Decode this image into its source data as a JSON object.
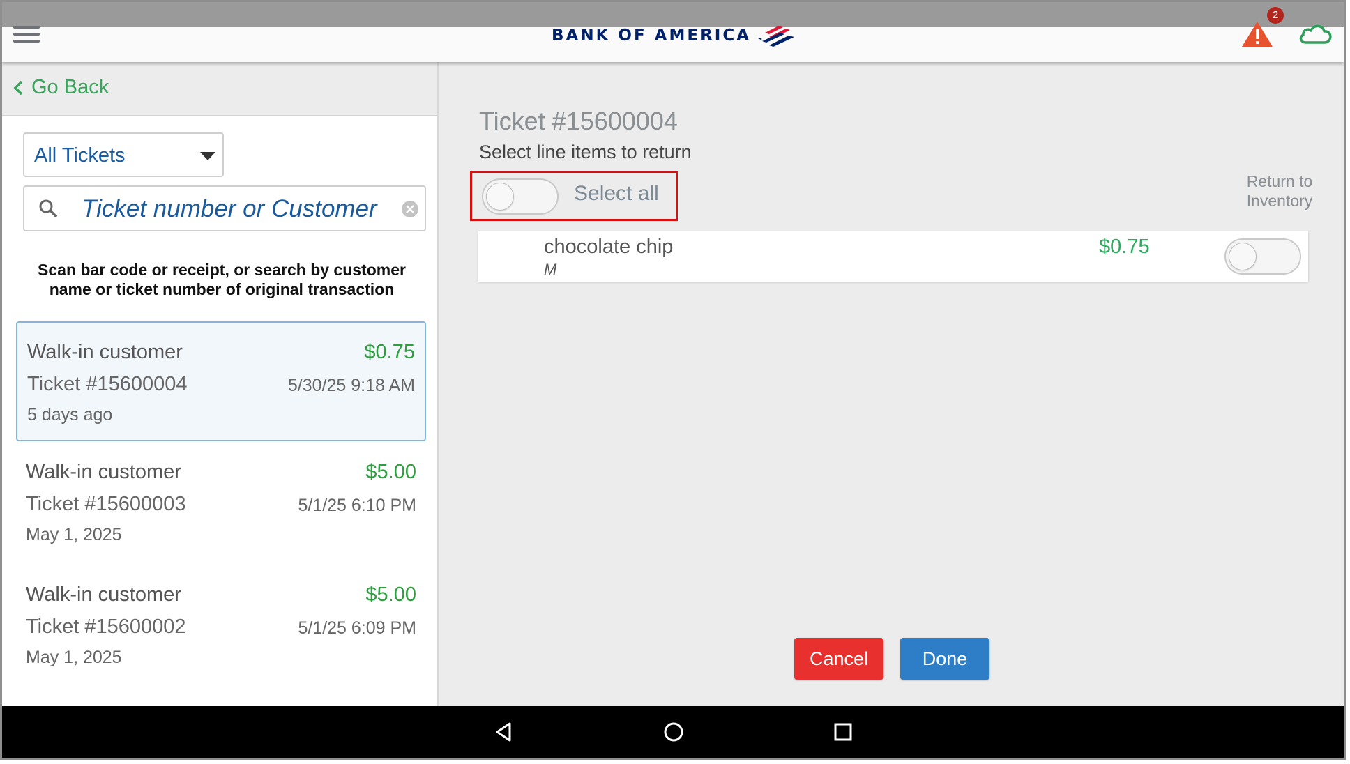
{
  "header": {
    "brand_name": "BANK OF AMERICA",
    "alert_count": "2",
    "icons": [
      "menu-icon",
      "warning-icon",
      "cloud-icon"
    ]
  },
  "left_panel": {
    "go_back_label": "Go Back",
    "filter_selected": "All Tickets",
    "search_placeholder": "Ticket number or Customer",
    "instructions": "Scan bar code or receipt, or search by customer name or ticket number of original transaction",
    "tickets": [
      {
        "customer": "Walk-in customer",
        "amount": "$0.75",
        "number": "Ticket #15600004",
        "datetime": "5/30/25 9:18 AM",
        "relative": "5 days ago",
        "selected": true
      },
      {
        "customer": "Walk-in customer",
        "amount": "$5.00",
        "number": "Ticket #15600003",
        "datetime": "5/1/25 6:10 PM",
        "relative": "May 1, 2025",
        "selected": false
      },
      {
        "customer": "Walk-in customer",
        "amount": "$5.00",
        "number": "Ticket #15600002",
        "datetime": "5/1/25 6:09 PM",
        "relative": "May 1, 2025",
        "selected": false
      }
    ]
  },
  "detail": {
    "title": "Ticket #15600004",
    "subtitle": "Select line items to return",
    "select_all_label": "Select all",
    "select_all_on": false,
    "return_to_inventory_label": "Return to Inventory",
    "line_items": [
      {
        "name": "chocolate chip",
        "variant": "M",
        "price": "$0.75",
        "return_to_inventory": false
      }
    ],
    "cancel_label": "Cancel",
    "done_label": "Done"
  },
  "colors": {
    "brand_navy": "#012169",
    "brand_red": "#e31837",
    "accent_green": "#2e9e3f",
    "link_blue": "#1a5a9e",
    "cancel_red": "#e8312f",
    "done_blue": "#2e7dc7",
    "highlight_red": "#d90f0f"
  }
}
